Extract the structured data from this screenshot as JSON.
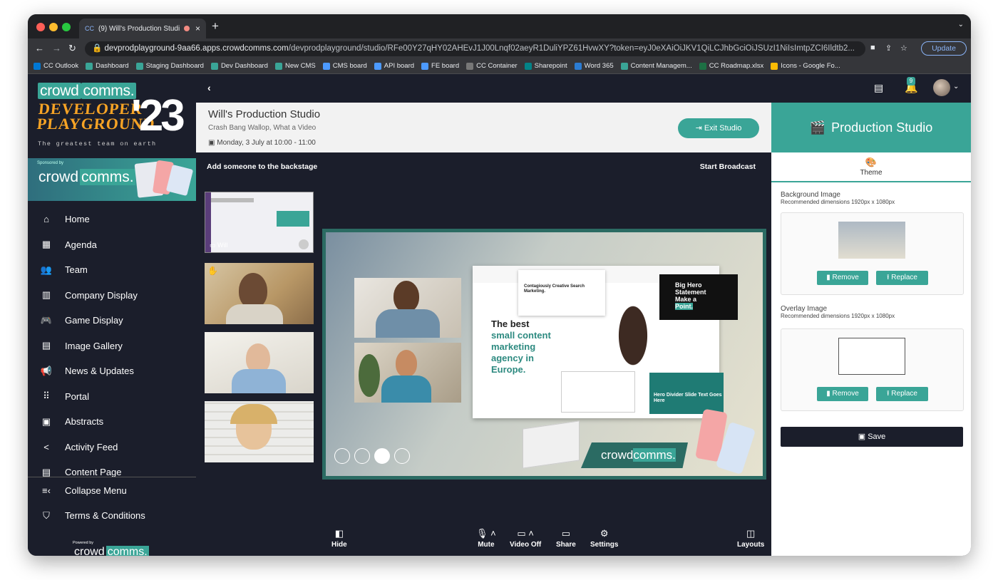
{
  "browser": {
    "tab_title": "(9) Will's Production Studi",
    "tab_favicon": "CC",
    "url_host": "devprodplayground-9aa66.apps.crowdcomms.com",
    "url_path": "/devprodplayground/studio/RFe00Y27qHY02AHEvJ1J00Lnqf02aeyR1DuliYPZ61HvwXY?token=eyJ0eXAiOiJKV1QiLCJhbGciOiJSUzI1NiIsImtpZCI6Ildtb2...",
    "update_label": "Update",
    "bookmarks": [
      {
        "label": "CC Outlook",
        "color": "#0078d4"
      },
      {
        "label": "Dashboard",
        "color": "#3aa597"
      },
      {
        "label": "Staging Dashboard",
        "color": "#3aa597"
      },
      {
        "label": "Dev Dashboard",
        "color": "#3aa597"
      },
      {
        "label": "New CMS",
        "color": "#3aa597"
      },
      {
        "label": "CMS board",
        "color": "#4c9aff"
      },
      {
        "label": "API board",
        "color": "#4c9aff"
      },
      {
        "label": "FE board",
        "color": "#4c9aff"
      },
      {
        "label": "CC Container",
        "color": "#777"
      },
      {
        "label": "Sharepoint",
        "color": "#038387"
      },
      {
        "label": "Word 365",
        "color": "#2b7cd3"
      },
      {
        "label": "Content Managem...",
        "color": "#3aa597"
      },
      {
        "label": "CC Roadmap.xlsx",
        "color": "#1d7044"
      },
      {
        "label": "Icons - Google Fo...",
        "color": "#fbbc04"
      }
    ]
  },
  "sidebar": {
    "logo_text": "crowd",
    "logo_highlight": "comms.",
    "event_line1": "DEVELOPER",
    "event_line2": "PLAYGROUND",
    "event_year": "'23",
    "tagline": "The greatest team on earth",
    "sponsor_label": "Sponsored by",
    "sponsor_text": "crowd",
    "sponsor_highlight": "comms.",
    "items": [
      {
        "label": "Home",
        "icon": "home-icon",
        "glyph": "⌂"
      },
      {
        "label": "Agenda",
        "icon": "agenda-icon",
        "glyph": "▦"
      },
      {
        "label": "Team",
        "icon": "team-icon",
        "glyph": "👥"
      },
      {
        "label": "Company Display",
        "icon": "company-icon",
        "glyph": "▥"
      },
      {
        "label": "Game Display",
        "icon": "game-icon",
        "glyph": "🎮"
      },
      {
        "label": "Image Gallery",
        "icon": "gallery-icon",
        "glyph": "▤"
      },
      {
        "label": "News & Updates",
        "icon": "megaphone-icon",
        "glyph": "📢"
      },
      {
        "label": "Portal",
        "icon": "portal-icon",
        "glyph": "⠿"
      },
      {
        "label": "Abstracts",
        "icon": "pdf-icon",
        "glyph": "▣"
      },
      {
        "label": "Activity Feed",
        "icon": "share-icon",
        "glyph": "<"
      },
      {
        "label": "Content Page",
        "icon": "content-icon",
        "glyph": "▤"
      }
    ],
    "collapse_label": "Collapse Menu",
    "terms_label": "Terms & Conditions",
    "powered_by": "Powered by",
    "powered_text": "crowd",
    "powered_highlight": "comms."
  },
  "topbar": {
    "notification_count": "9"
  },
  "session": {
    "title": "Will's Production Studio",
    "subtitle": "Crash Bang Wallop, What a Video",
    "datetime": "Monday, 3 July at 10:00 - 11:00",
    "exit_label": "Exit Studio"
  },
  "stage": {
    "add_backstage": "Add someone to the backstage",
    "start_broadcast": "Start Broadcast",
    "first_participant": "Will",
    "slide": {
      "heading": "The best",
      "highlight_lines": [
        "small content",
        "marketing",
        "agency in",
        "Europe."
      ],
      "hero_lines": [
        "Big Hero",
        "Statement",
        "Make a"
      ],
      "hero_highlight": "Point.",
      "divider_text": "Hero Divider Slide Text Goes Here",
      "card_text": "Contagiously Creative Search Marketing."
    },
    "banner_text": "crowd",
    "banner_highlight": "comms."
  },
  "controls": {
    "hide": "Hide",
    "mute": "Mute",
    "video_off": "Video Off",
    "share": "Share",
    "settings": "Settings",
    "layouts": "Layouts"
  },
  "panel": {
    "title": "Production Studio",
    "tab_theme": "Theme",
    "bg_label": "Background Image",
    "bg_hint": "Recommended dimensions 1920px x 1080px",
    "overlay_label": "Overlay Image",
    "overlay_hint": "Recommended dimensions 1920px x 1080px",
    "remove": "Remove",
    "replace": "Replace",
    "save": "Save"
  },
  "colors": {
    "accent": "#3aa597",
    "dark": "#1b1e2b",
    "event_orange": "#f6a325"
  }
}
